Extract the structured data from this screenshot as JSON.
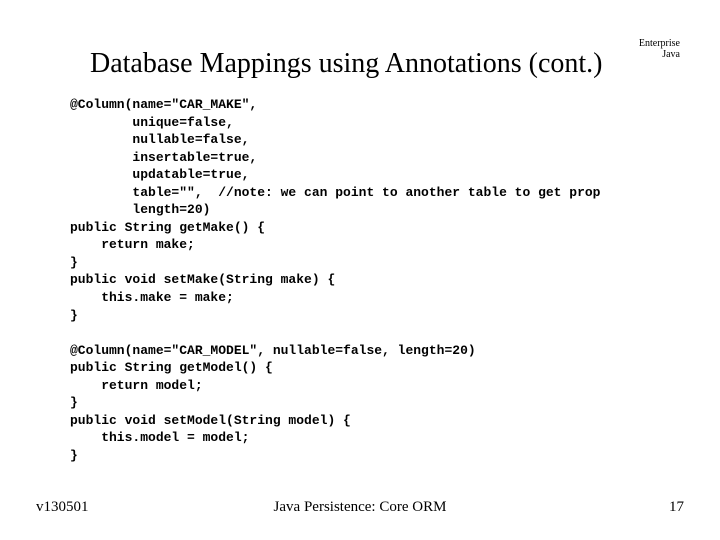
{
  "title": "Database Mappings using Annotations (cont.)",
  "corner": {
    "line1": "Enterprise",
    "line2": "Java"
  },
  "code": "@Column(name=\"CAR_MAKE\",\n        unique=false,\n        nullable=false,\n        insertable=true,\n        updatable=true,\n        table=\"\",  //note: we can point to another table to get prop\n        length=20)\npublic String getMake() {\n    return make;\n}\npublic void setMake(String make) {\n    this.make = make;\n}\n\n@Column(name=\"CAR_MODEL\", nullable=false, length=20)\npublic String getModel() {\n    return model;\n}\npublic void setModel(String model) {\n    this.model = model;\n}",
  "footer": {
    "left": "v130501",
    "center": "Java Persistence: Core ORM",
    "right": "17"
  }
}
